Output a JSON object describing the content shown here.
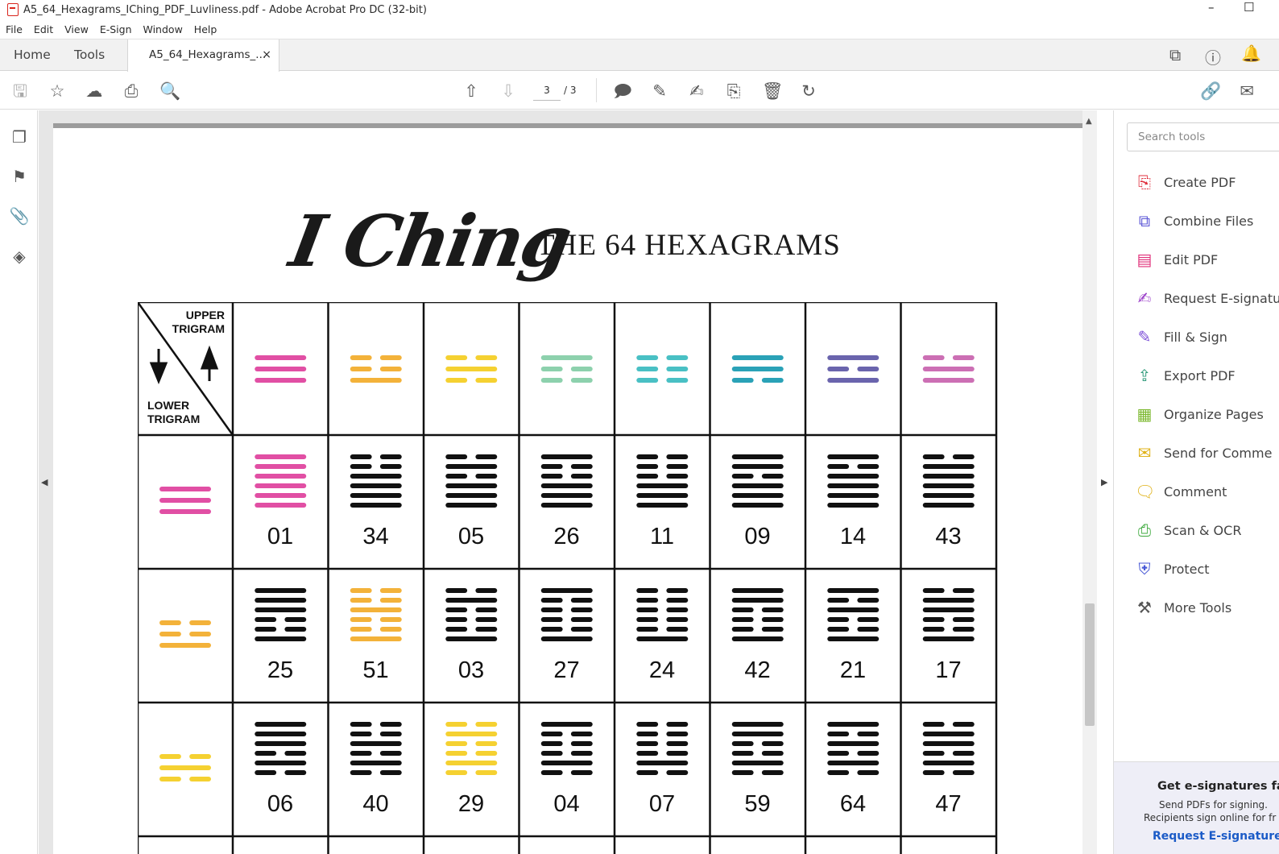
{
  "window": {
    "title": "A5_64_Hexagrams_IChing_PDF_Luvliness.pdf - Adobe Acrobat Pro DC (32-bit)",
    "minimize": "–",
    "maximize": "☐"
  },
  "menu": [
    "File",
    "Edit",
    "View",
    "E-Sign",
    "Window",
    "Help"
  ],
  "tabs": {
    "home": "Home",
    "tools": "Tools",
    "document": "A5_64_Hexagrams_...",
    "close": "×"
  },
  "toolbar": {
    "page_current": "3",
    "page_total": "/ 3"
  },
  "right_pane": {
    "search_placeholder": "Search tools",
    "tools": [
      {
        "label": "Create PDF",
        "icon": "create-pdf-icon",
        "color": "#e0313f"
      },
      {
        "label": "Combine Files",
        "icon": "combine-files-icon",
        "color": "#5a55d6"
      },
      {
        "label": "Edit PDF",
        "icon": "edit-pdf-icon",
        "color": "#e0317a"
      },
      {
        "label": "Request E-signatu",
        "icon": "request-esign-icon",
        "color": "#9b3fc9"
      },
      {
        "label": "Fill & Sign",
        "icon": "fill-sign-icon",
        "color": "#7a4cd6"
      },
      {
        "label": "Export PDF",
        "icon": "export-pdf-icon",
        "color": "#2f9a7a"
      },
      {
        "label": "Organize Pages",
        "icon": "organize-pages-icon",
        "color": "#7cb82f"
      },
      {
        "label": "Send for Comme",
        "icon": "send-comment-icon",
        "color": "#e0b31b"
      },
      {
        "label": "Comment",
        "icon": "comment-icon",
        "color": "#e0b31b"
      },
      {
        "label": "Scan & OCR",
        "icon": "scan-ocr-icon",
        "color": "#3aa83a"
      },
      {
        "label": "Protect",
        "icon": "protect-icon",
        "color": "#4a5ad6"
      },
      {
        "label": "More Tools",
        "icon": "more-tools-icon",
        "color": "#555555"
      }
    ],
    "esign_promo": {
      "heading": "Get e-signatures fa",
      "line1": "Send PDFs for signing.",
      "line2": "Recipients sign online for fr",
      "action": "Request E-signature"
    }
  },
  "document": {
    "title_script": "I Ching",
    "title_sub": "THE 64 HEXAGRAMS",
    "corner_upper": [
      "UPPER",
      "TRIGRAM"
    ],
    "corner_lower": [
      "LOWER",
      "TRIGRAM"
    ],
    "colors": {
      "heaven": "#e14fa4",
      "thunder": "#f3b23a",
      "water": "#f5d131",
      "mountain": "#8dd1ad",
      "earth": "#49c0c4",
      "wind": "#2aa2b7",
      "fire": "#6a64ad",
      "lake": "#cc6fb4",
      "black": "#111111"
    },
    "upper_trigrams": [
      {
        "name": "heaven",
        "lines": [
          1,
          1,
          1
        ]
      },
      {
        "name": "thunder",
        "lines": [
          0,
          0,
          1
        ]
      },
      {
        "name": "water",
        "lines": [
          0,
          1,
          0
        ]
      },
      {
        "name": "mountain",
        "lines": [
          1,
          0,
          0
        ]
      },
      {
        "name": "earth",
        "lines": [
          0,
          0,
          0
        ]
      },
      {
        "name": "wind",
        "lines": [
          1,
          1,
          0
        ]
      },
      {
        "name": "fire",
        "lines": [
          1,
          0,
          1
        ]
      },
      {
        "name": "lake",
        "lines": [
          0,
          1,
          1
        ]
      }
    ],
    "rows": [
      {
        "lower": {
          "name": "heaven",
          "lines": [
            1,
            1,
            1
          ]
        },
        "numbers": [
          "01",
          "34",
          "05",
          "26",
          "11",
          "09",
          "14",
          "43"
        ]
      },
      {
        "lower": {
          "name": "thunder",
          "lines": [
            0,
            0,
            1
          ]
        },
        "numbers": [
          "25",
          "51",
          "03",
          "27",
          "24",
          "42",
          "21",
          "17"
        ]
      },
      {
        "lower": {
          "name": "water",
          "lines": [
            0,
            1,
            0
          ]
        },
        "numbers": [
          "06",
          "40",
          "29",
          "04",
          "07",
          "59",
          "64",
          "47"
        ]
      }
    ]
  }
}
